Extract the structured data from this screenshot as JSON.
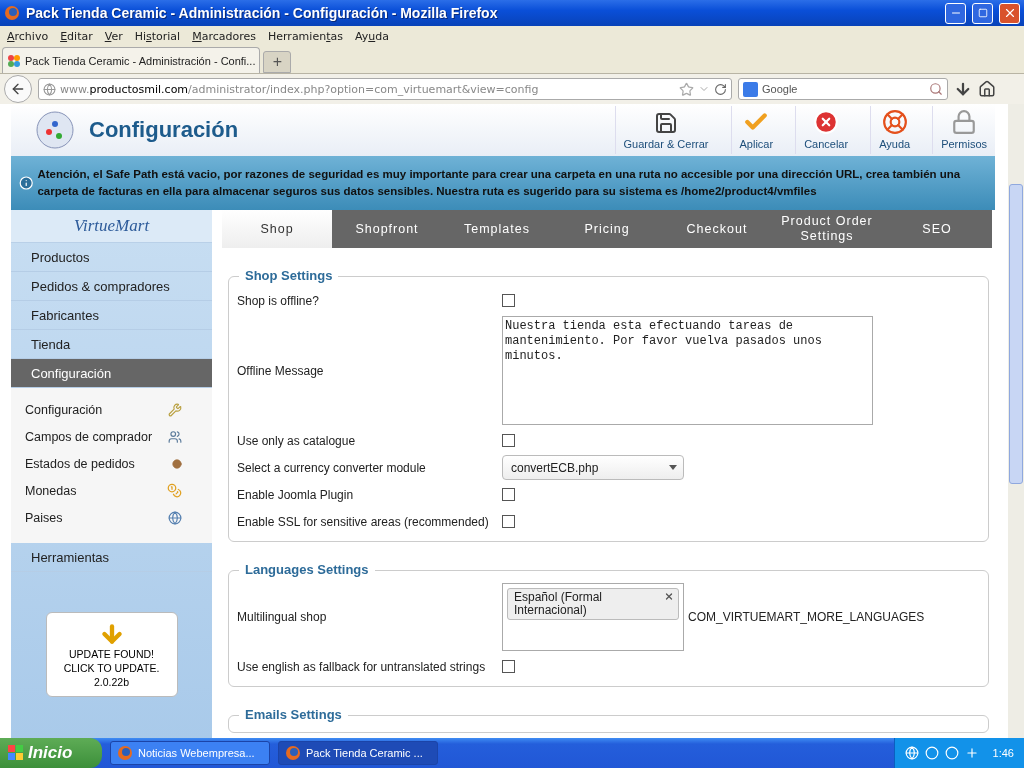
{
  "window": {
    "title": "Pack Tienda Ceramic - Administración - Configuración - Mozilla Firefox"
  },
  "menu": [
    {
      "key": "A",
      "after": "rchivo"
    },
    {
      "key": "E",
      "after": "ditar"
    },
    {
      "key": "V",
      "after": "er"
    },
    {
      "before": "Hi",
      "key": "s",
      "after": "torial"
    },
    {
      "key": "M",
      "after": "arcadores"
    },
    {
      "before": "Herramien",
      "key": "t",
      "after": "as"
    },
    {
      "before": "Ay",
      "key": "u",
      "after": "da"
    }
  ],
  "browser_tabs": [
    {
      "title": "Pack Tienda Ceramic - Administración - Confi...",
      "selected": true
    }
  ],
  "new_tab": "+",
  "address": {
    "prefix": "www.",
    "host": "productosmil.com",
    "path": "/administrator/index.php?option=com_virtuemart&view=config"
  },
  "search": {
    "placeholder": "Google"
  },
  "page": {
    "title": "Configuración",
    "toolbar": [
      {
        "label": "Guardar & Cerrar",
        "kind": "save"
      },
      {
        "label": "Aplicar",
        "kind": "apply"
      },
      {
        "label": "Cancelar",
        "kind": "cancel"
      },
      {
        "label": "Ayuda",
        "kind": "help"
      },
      {
        "label": "Permisos",
        "kind": "permissions"
      }
    ],
    "notice": "Atención, el Safe Path está vacio, por razones de seguridad es muy importante para crear una carpeta en una ruta no accesible por una dirección URL, crea también una carpeta de facturas en ella para almacenar seguros sus datos sensibles. Nuestra ruta es sugerido para su sistema es /home2/product4/vmfiles",
    "sidebar": {
      "logo": "VirtueMart",
      "items": [
        {
          "label": "Productos",
          "selected": false
        },
        {
          "label": "Pedidos & compradores",
          "selected": false
        },
        {
          "label": "Fabricantes",
          "selected": false
        },
        {
          "label": "Tienda",
          "selected": false
        },
        {
          "label": "Configuración",
          "selected": true
        }
      ],
      "subitems": [
        {
          "label": "Configuración",
          "kind": "tools"
        },
        {
          "label": "Campos de comprador",
          "kind": "users"
        },
        {
          "label": "Estados de pedidos",
          "kind": "status"
        },
        {
          "label": "Monedas",
          "kind": "coins"
        },
        {
          "label": "Paises",
          "kind": "globe"
        }
      ],
      "tools": "Herramientas",
      "update": {
        "text": "UPDATE FOUND! CLICK TO UPDATE.",
        "version": "2.0.22b"
      }
    },
    "tabs": [
      {
        "label": "Shop",
        "selected": true
      },
      {
        "label": "Shopfront",
        "selected": false
      },
      {
        "label": "Templates",
        "selected": false
      },
      {
        "label": "Pricing",
        "selected": false
      },
      {
        "label": "Checkout",
        "selected": false
      },
      {
        "label": "Product Order Settings",
        "selected": false
      },
      {
        "label": "SEO",
        "selected": false
      }
    ],
    "sections": [
      {
        "title": "Shop Settings",
        "rows": [
          {
            "kind": "checkbox",
            "label": "Shop is offline?",
            "checked": false
          },
          {
            "kind": "textarea",
            "label": "Offline Message",
            "value": "Nuestra tienda esta efectuando tareas de mantenimiento. Por favor vuelva pasados unos minutos."
          },
          {
            "kind": "checkbox",
            "label": "Use only as catalogue",
            "checked": false
          },
          {
            "kind": "select",
            "label": "Select a currency converter module",
            "value": "convertECB.php"
          },
          {
            "kind": "checkbox",
            "label": "Enable Joomla Plugin",
            "checked": false
          },
          {
            "kind": "checkbox",
            "label": "Enable SSL for sensitive areas (recommended)",
            "checked": false
          }
        ]
      },
      {
        "title": "Languages Settings",
        "rows": [
          {
            "kind": "multiselect",
            "label": "Multilingual shop",
            "chips": [
              "Español (Formal Internacional)"
            ],
            "note": "COM_VIRTUEMART_MORE_LANGUAGES"
          },
          {
            "kind": "checkbox",
            "label": "Use english as fallback for untranslated strings",
            "checked": false
          }
        ]
      },
      {
        "title": "Emails Settings"
      }
    ]
  },
  "taskbar": {
    "start": "Inicio",
    "tasks": [
      {
        "label": "Noticias Webempresa...",
        "selected": false
      },
      {
        "label": "Pack Tienda Ceramic ...",
        "selected": true
      }
    ],
    "clock": "1:46"
  }
}
